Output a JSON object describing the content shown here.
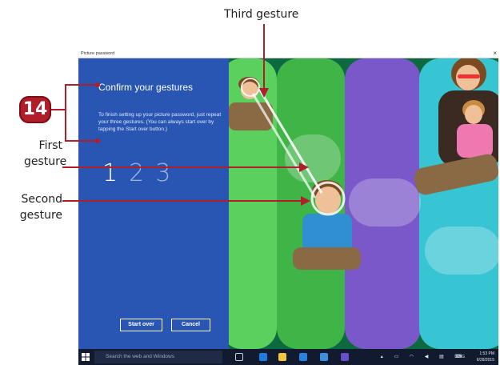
{
  "callouts": {
    "third_gesture": "Third gesture",
    "first_gesture_line1": "First",
    "first_gesture_line2": "gesture",
    "second_gesture_line1": "Second",
    "second_gesture_line2": "gesture",
    "step_number": "14"
  },
  "window": {
    "title": "Picture password",
    "close_glyph": "×"
  },
  "left_pane": {
    "heading": "Confirm your gestures",
    "body": "To finish setting up your picture password, just repeat your three gestures. (You can always start over by tapping the Start over button.)",
    "digits": [
      "1",
      "2",
      "3"
    ],
    "start_over_label": "Start over",
    "cancel_label": "Cancel"
  },
  "taskbar": {
    "search_placeholder": "Search the web and Windows",
    "lang": "ENG",
    "time": "1:53 PM",
    "date": "6/28/2015"
  },
  "colors": {
    "accent_red": "#b01e2a",
    "pane_blue": "#2a56b3",
    "taskbar": "#111a2f"
  },
  "icons": [
    "windows-start-icon",
    "task-view-icon",
    "edge-icon",
    "file-explorer-icon",
    "store-icon",
    "photos-icon",
    "settings-icon",
    "tray-chevron-icon",
    "network-icon",
    "volume-icon",
    "notifications-icon",
    "keyboard-icon"
  ]
}
